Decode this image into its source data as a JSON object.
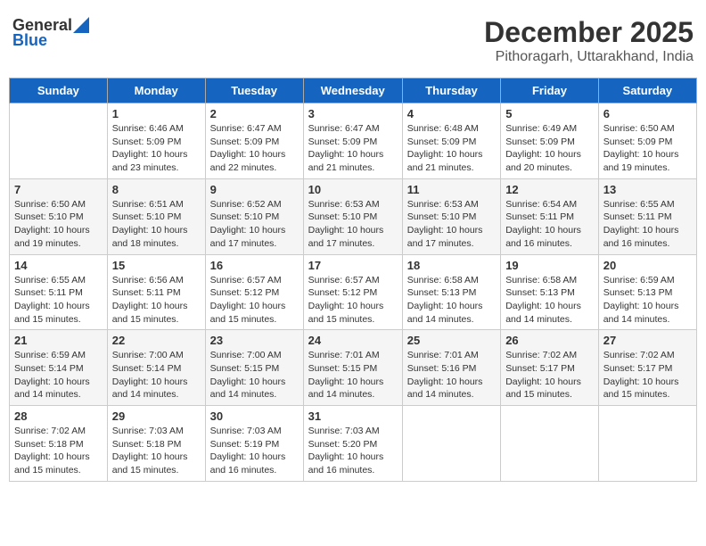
{
  "logo": {
    "general": "General",
    "blue": "Blue"
  },
  "title": "December 2025",
  "subtitle": "Pithoragarh, Uttarakhand, India",
  "days_of_week": [
    "Sunday",
    "Monday",
    "Tuesday",
    "Wednesday",
    "Thursday",
    "Friday",
    "Saturday"
  ],
  "weeks": [
    [
      {
        "day": "",
        "sunrise": "",
        "sunset": "",
        "daylight": ""
      },
      {
        "day": "1",
        "sunrise": "Sunrise: 6:46 AM",
        "sunset": "Sunset: 5:09 PM",
        "daylight": "Daylight: 10 hours and 23 minutes."
      },
      {
        "day": "2",
        "sunrise": "Sunrise: 6:47 AM",
        "sunset": "Sunset: 5:09 PM",
        "daylight": "Daylight: 10 hours and 22 minutes."
      },
      {
        "day": "3",
        "sunrise": "Sunrise: 6:47 AM",
        "sunset": "Sunset: 5:09 PM",
        "daylight": "Daylight: 10 hours and 21 minutes."
      },
      {
        "day": "4",
        "sunrise": "Sunrise: 6:48 AM",
        "sunset": "Sunset: 5:09 PM",
        "daylight": "Daylight: 10 hours and 21 minutes."
      },
      {
        "day": "5",
        "sunrise": "Sunrise: 6:49 AM",
        "sunset": "Sunset: 5:09 PM",
        "daylight": "Daylight: 10 hours and 20 minutes."
      },
      {
        "day": "6",
        "sunrise": "Sunrise: 6:50 AM",
        "sunset": "Sunset: 5:09 PM",
        "daylight": "Daylight: 10 hours and 19 minutes."
      }
    ],
    [
      {
        "day": "7",
        "sunrise": "Sunrise: 6:50 AM",
        "sunset": "Sunset: 5:10 PM",
        "daylight": "Daylight: 10 hours and 19 minutes."
      },
      {
        "day": "8",
        "sunrise": "Sunrise: 6:51 AM",
        "sunset": "Sunset: 5:10 PM",
        "daylight": "Daylight: 10 hours and 18 minutes."
      },
      {
        "day": "9",
        "sunrise": "Sunrise: 6:52 AM",
        "sunset": "Sunset: 5:10 PM",
        "daylight": "Daylight: 10 hours and 17 minutes."
      },
      {
        "day": "10",
        "sunrise": "Sunrise: 6:53 AM",
        "sunset": "Sunset: 5:10 PM",
        "daylight": "Daylight: 10 hours and 17 minutes."
      },
      {
        "day": "11",
        "sunrise": "Sunrise: 6:53 AM",
        "sunset": "Sunset: 5:10 PM",
        "daylight": "Daylight: 10 hours and 17 minutes."
      },
      {
        "day": "12",
        "sunrise": "Sunrise: 6:54 AM",
        "sunset": "Sunset: 5:11 PM",
        "daylight": "Daylight: 10 hours and 16 minutes."
      },
      {
        "day": "13",
        "sunrise": "Sunrise: 6:55 AM",
        "sunset": "Sunset: 5:11 PM",
        "daylight": "Daylight: 10 hours and 16 minutes."
      }
    ],
    [
      {
        "day": "14",
        "sunrise": "Sunrise: 6:55 AM",
        "sunset": "Sunset: 5:11 PM",
        "daylight": "Daylight: 10 hours and 15 minutes."
      },
      {
        "day": "15",
        "sunrise": "Sunrise: 6:56 AM",
        "sunset": "Sunset: 5:11 PM",
        "daylight": "Daylight: 10 hours and 15 minutes."
      },
      {
        "day": "16",
        "sunrise": "Sunrise: 6:57 AM",
        "sunset": "Sunset: 5:12 PM",
        "daylight": "Daylight: 10 hours and 15 minutes."
      },
      {
        "day": "17",
        "sunrise": "Sunrise: 6:57 AM",
        "sunset": "Sunset: 5:12 PM",
        "daylight": "Daylight: 10 hours and 15 minutes."
      },
      {
        "day": "18",
        "sunrise": "Sunrise: 6:58 AM",
        "sunset": "Sunset: 5:13 PM",
        "daylight": "Daylight: 10 hours and 14 minutes."
      },
      {
        "day": "19",
        "sunrise": "Sunrise: 6:58 AM",
        "sunset": "Sunset: 5:13 PM",
        "daylight": "Daylight: 10 hours and 14 minutes."
      },
      {
        "day": "20",
        "sunrise": "Sunrise: 6:59 AM",
        "sunset": "Sunset: 5:13 PM",
        "daylight": "Daylight: 10 hours and 14 minutes."
      }
    ],
    [
      {
        "day": "21",
        "sunrise": "Sunrise: 6:59 AM",
        "sunset": "Sunset: 5:14 PM",
        "daylight": "Daylight: 10 hours and 14 minutes."
      },
      {
        "day": "22",
        "sunrise": "Sunrise: 7:00 AM",
        "sunset": "Sunset: 5:14 PM",
        "daylight": "Daylight: 10 hours and 14 minutes."
      },
      {
        "day": "23",
        "sunrise": "Sunrise: 7:00 AM",
        "sunset": "Sunset: 5:15 PM",
        "daylight": "Daylight: 10 hours and 14 minutes."
      },
      {
        "day": "24",
        "sunrise": "Sunrise: 7:01 AM",
        "sunset": "Sunset: 5:15 PM",
        "daylight": "Daylight: 10 hours and 14 minutes."
      },
      {
        "day": "25",
        "sunrise": "Sunrise: 7:01 AM",
        "sunset": "Sunset: 5:16 PM",
        "daylight": "Daylight: 10 hours and 14 minutes."
      },
      {
        "day": "26",
        "sunrise": "Sunrise: 7:02 AM",
        "sunset": "Sunset: 5:17 PM",
        "daylight": "Daylight: 10 hours and 15 minutes."
      },
      {
        "day": "27",
        "sunrise": "Sunrise: 7:02 AM",
        "sunset": "Sunset: 5:17 PM",
        "daylight": "Daylight: 10 hours and 15 minutes."
      }
    ],
    [
      {
        "day": "28",
        "sunrise": "Sunrise: 7:02 AM",
        "sunset": "Sunset: 5:18 PM",
        "daylight": "Daylight: 10 hours and 15 minutes."
      },
      {
        "day": "29",
        "sunrise": "Sunrise: 7:03 AM",
        "sunset": "Sunset: 5:18 PM",
        "daylight": "Daylight: 10 hours and 15 minutes."
      },
      {
        "day": "30",
        "sunrise": "Sunrise: 7:03 AM",
        "sunset": "Sunset: 5:19 PM",
        "daylight": "Daylight: 10 hours and 16 minutes."
      },
      {
        "day": "31",
        "sunrise": "Sunrise: 7:03 AM",
        "sunset": "Sunset: 5:20 PM",
        "daylight": "Daylight: 10 hours and 16 minutes."
      },
      {
        "day": "",
        "sunrise": "",
        "sunset": "",
        "daylight": ""
      },
      {
        "day": "",
        "sunrise": "",
        "sunset": "",
        "daylight": ""
      },
      {
        "day": "",
        "sunrise": "",
        "sunset": "",
        "daylight": ""
      }
    ]
  ]
}
